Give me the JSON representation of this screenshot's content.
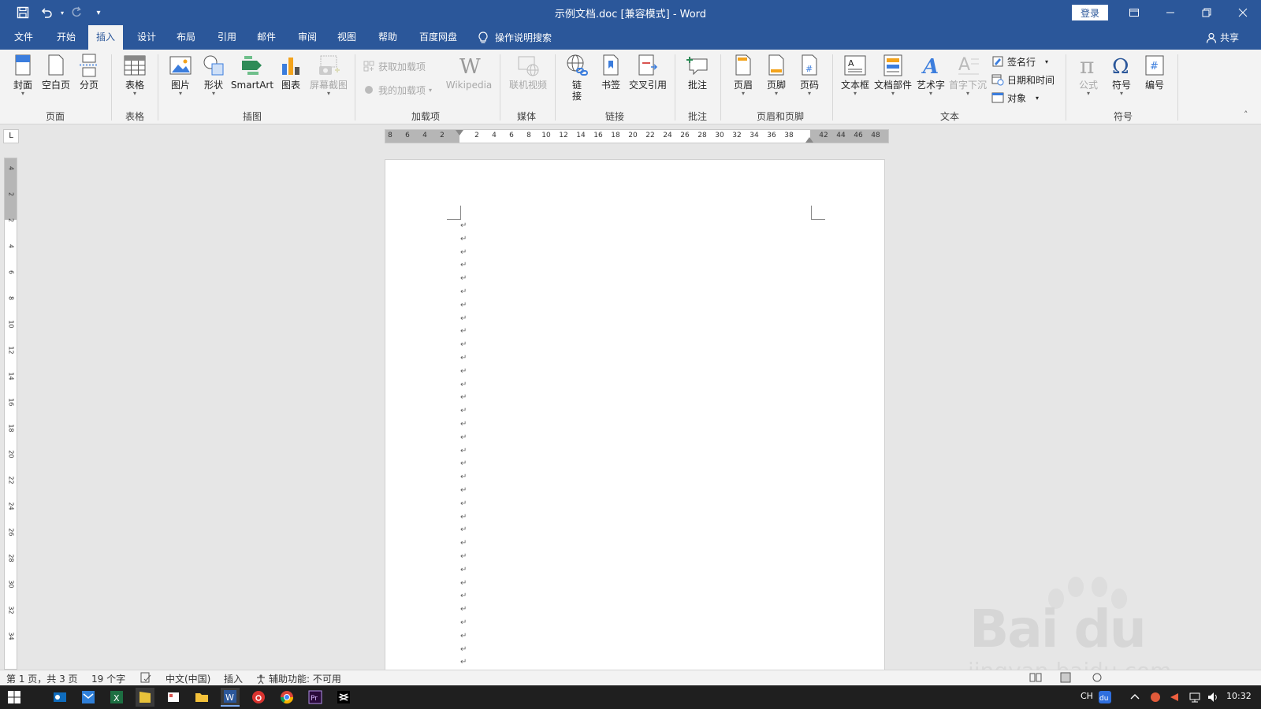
{
  "app": {
    "window_title": "示例文档.doc [兼容模式]  -  Word",
    "login_label": "登录",
    "share_label": "共享"
  },
  "tabs": [
    {
      "label": "文件"
    },
    {
      "label": "开始"
    },
    {
      "label": "插入",
      "active": true
    },
    {
      "label": "设计"
    },
    {
      "label": "布局"
    },
    {
      "label": "引用"
    },
    {
      "label": "邮件"
    },
    {
      "label": "审阅"
    },
    {
      "label": "视图"
    },
    {
      "label": "帮助"
    },
    {
      "label": "百度网盘"
    }
  ],
  "tell_me": "操作说明搜索",
  "ribbon": {
    "pages": {
      "group": "页面",
      "cover": "封面",
      "blank": "空白页",
      "break": "分页"
    },
    "tables": {
      "group": "表格",
      "table": "表格"
    },
    "illustrations": {
      "group": "插图",
      "picture": "图片",
      "shapes": "形状",
      "smartart": "SmartArt",
      "chart": "图表",
      "screenshot": "屏幕截图"
    },
    "addins": {
      "group": "加载项",
      "get": "获取加载项",
      "mine": "我的加载项",
      "wikipedia": "Wikipedia"
    },
    "media": {
      "group": "媒体",
      "video": "联机视频"
    },
    "links": {
      "group": "链接",
      "link_1": "链",
      "link_2": "接",
      "bookmark": "书签",
      "crossref": "交叉引用"
    },
    "comments": {
      "group": "批注",
      "comment": "批注"
    },
    "headerfooter": {
      "group": "页眉和页脚",
      "header": "页眉",
      "footer": "页脚",
      "pagenum": "页码"
    },
    "text": {
      "group": "文本",
      "textbox": "文本框",
      "parts": "文档部件",
      "wordart": "艺术字",
      "dropcap": "首字下沉",
      "signature": "签名行",
      "datetime": "日期和时间",
      "object": "对象"
    },
    "symbols": {
      "group": "符号",
      "equation": "公式",
      "symbol": "符号",
      "number": "编号"
    }
  },
  "ruler": {
    "corner": "L",
    "h_numbers": [
      "8",
      "6",
      "4",
      "2",
      "2",
      "4",
      "6",
      "8",
      "10",
      "12",
      "14",
      "16",
      "18",
      "20",
      "22",
      "24",
      "26",
      "28",
      "30",
      "32",
      "34",
      "36",
      "38",
      "42",
      "44",
      "46",
      "48"
    ],
    "v_numbers": [
      "4",
      "2",
      "2",
      "4",
      "6",
      "8",
      "10",
      "12",
      "14",
      "16",
      "18",
      "20",
      "22",
      "24",
      "26",
      "28",
      "30",
      "32",
      "34"
    ]
  },
  "document": {
    "paragraph_mark": "↵",
    "paragraph_count": 34
  },
  "status": {
    "page": "第 1 页，共 3 页",
    "words": "19 个字",
    "language": "中文(中国)",
    "mode": "插入",
    "accessibility": "辅助功能: 不可用"
  },
  "taskbar": {
    "ime": "CH",
    "time": "10:32"
  },
  "watermark": {
    "main": "Bai du 经验",
    "sub": "jingyan.baidu.com"
  }
}
